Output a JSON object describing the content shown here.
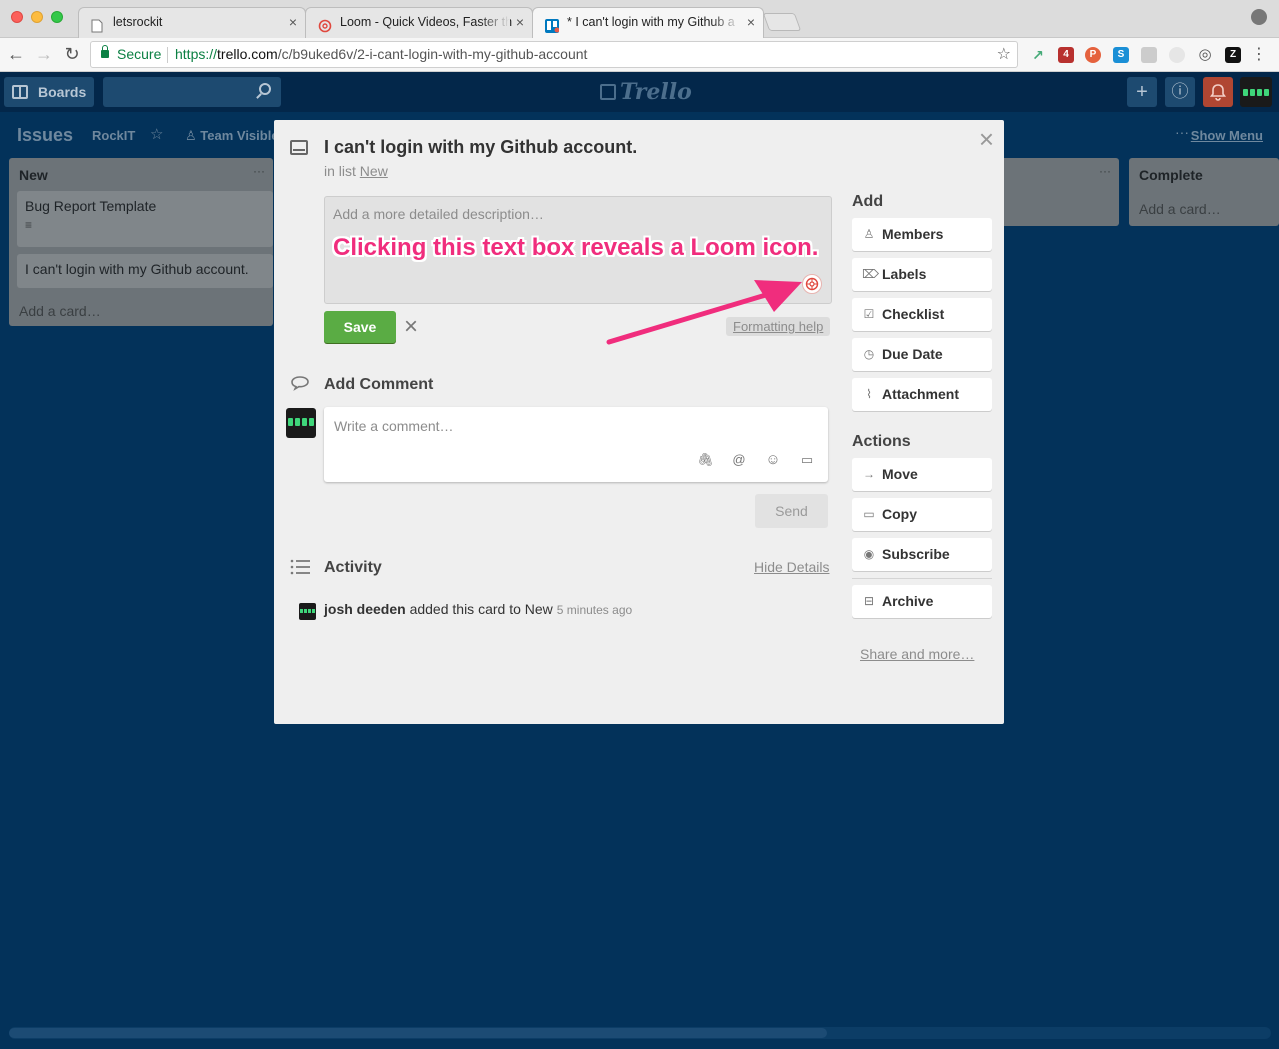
{
  "browser": {
    "tabs": [
      {
        "title": "letsrockit",
        "close": "×"
      },
      {
        "title": "Loom - Quick Videos, Faster th",
        "close": "×"
      },
      {
        "title": "* I can't login with my Github a",
        "close": "×"
      }
    ],
    "secure_label": "Secure",
    "url_scheme": "https://",
    "url_host": "trello.com",
    "url_path": "/c/b9uked6v/2-i-cant-login-with-my-github-account",
    "back": "←",
    "forward": "→",
    "reload": "↻",
    "bookmark_star": "☆",
    "menu": "⋮",
    "extension_badge": "4"
  },
  "trello_header": {
    "boards_label": "Boards",
    "logo_text": "Trello",
    "add_icon": "+",
    "info_icon": "ⓘ",
    "bell_icon": "🔔"
  },
  "board": {
    "title": "Issues",
    "org": "RockIT",
    "star": "☆",
    "visibility": "Team Visible",
    "show_menu": "Show Menu",
    "menu_dots": "···",
    "lists": [
      {
        "title": "New",
        "cards": [
          "Bug Report Template",
          "I can't login with my Github account."
        ],
        "add_card": "Add a card…",
        "desc_badge": "≡"
      },
      {
        "title": "Complete",
        "add_card": "Add a card…"
      }
    ],
    "list_dots": "···"
  },
  "card_modal": {
    "title": "I can't login with my Github account.",
    "in_list_prefix": "in list",
    "list_name": "New",
    "close": "×",
    "description_placeholder": "Add a more detailed description…",
    "annotation": "Clicking this text box reveals a Loom icon.",
    "save": "Save",
    "cancel": "×",
    "formatting_help": "Formatting help",
    "add_comment_title": "Add Comment",
    "comment_placeholder": "Write a comment…",
    "comment_tools": [
      "🖇",
      "@",
      "☺",
      "▭"
    ],
    "send": "Send",
    "activity_title": "Activity",
    "hide_details": "Hide Details",
    "activity": {
      "user": "josh deeden",
      "action": " added this card to New",
      "when": "5 minutes ago"
    },
    "sidebar": {
      "add_title": "Add",
      "add_buttons": [
        {
          "label": "Members",
          "icon": "♙"
        },
        {
          "label": "Labels",
          "icon": "⌦"
        },
        {
          "label": "Checklist",
          "icon": "☑"
        },
        {
          "label": "Due Date",
          "icon": "◷"
        },
        {
          "label": "Attachment",
          "icon": "⌇"
        }
      ],
      "actions_title": "Actions",
      "action_buttons": [
        {
          "label": "Move",
          "icon": "→"
        },
        {
          "label": "Copy",
          "icon": "▭"
        },
        {
          "label": "Subscribe",
          "icon": "◉"
        },
        {
          "label": "Archive",
          "icon": "⊟"
        }
      ],
      "share_more": "Share and more…"
    }
  },
  "colors": {
    "board_bg": "#03325a",
    "annotation": "#f02d7d",
    "save_green": "#5aac44",
    "notification_red": "#b04632"
  }
}
